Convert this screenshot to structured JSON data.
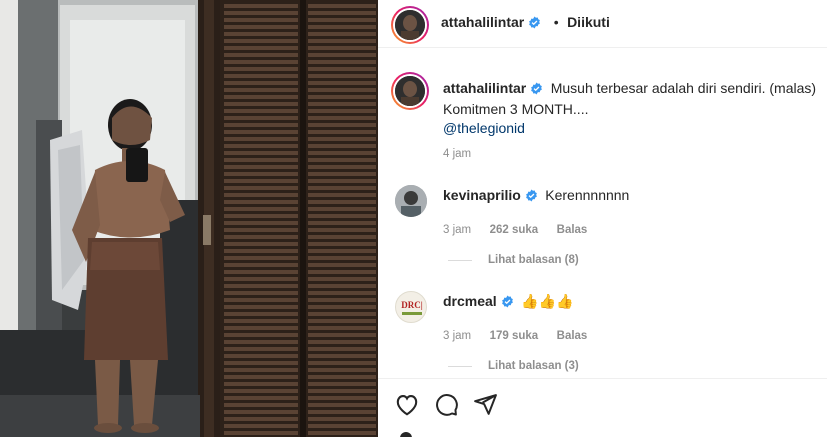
{
  "post": {
    "author": "attahalilintar",
    "follow_status": "Diikuti",
    "separator": "•",
    "caption": {
      "username": "attahalilintar",
      "line1": "Musuh terbesar adalah diri sendiri. (malas)",
      "line2": "Komitmen 3 MONTH....",
      "mention": "@thelegionid",
      "time": "4 jam"
    }
  },
  "comments": [
    {
      "username": "kevinaprilio",
      "text": "Kerennnnnnn",
      "time": "3 jam",
      "likes": "262 suka",
      "reply_label": "Balas",
      "view_replies": "Lihat balasan (8)"
    },
    {
      "username": "drcmeal",
      "text": "👍👍👍",
      "time": "3 jam",
      "likes": "179 suka",
      "reply_label": "Balas",
      "view_replies": "Lihat balasan (3)",
      "avatar_text": "DRC|"
    }
  ],
  "icons": {
    "like": "heart-icon",
    "comment": "comment-icon",
    "share": "paper-plane-icon",
    "verified": "verified-badge-icon"
  },
  "colors": {
    "verified": "#3897f0",
    "text": "#262626",
    "muted": "#8e8e8e",
    "mention": "#00376b"
  }
}
